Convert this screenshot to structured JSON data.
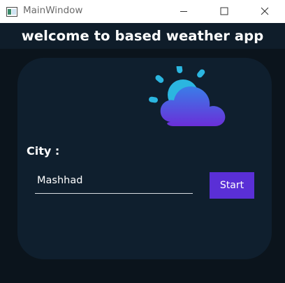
{
  "window": {
    "title": "MainWindow",
    "controls": {
      "minimize_icon": "minimize-icon",
      "maximize_icon": "maximize-icon",
      "close_icon": "close-icon"
    }
  },
  "header": {
    "welcome_text": "welcome to based weather app"
  },
  "main": {
    "weather_icon": "partly-cloudy-icon",
    "city_label": "City :",
    "city_value": "Mashhad",
    "start_label": "Start"
  },
  "colors": {
    "window_background": "#0b141c",
    "header_background": "#0f1d2a",
    "card_background": "#0f1f2e",
    "button_background": "#5a2fd6",
    "sun_color": "#2bb6e0",
    "cloud_gradient_top": "#3a7de8",
    "cloud_gradient_bottom": "#6a2fd8"
  }
}
